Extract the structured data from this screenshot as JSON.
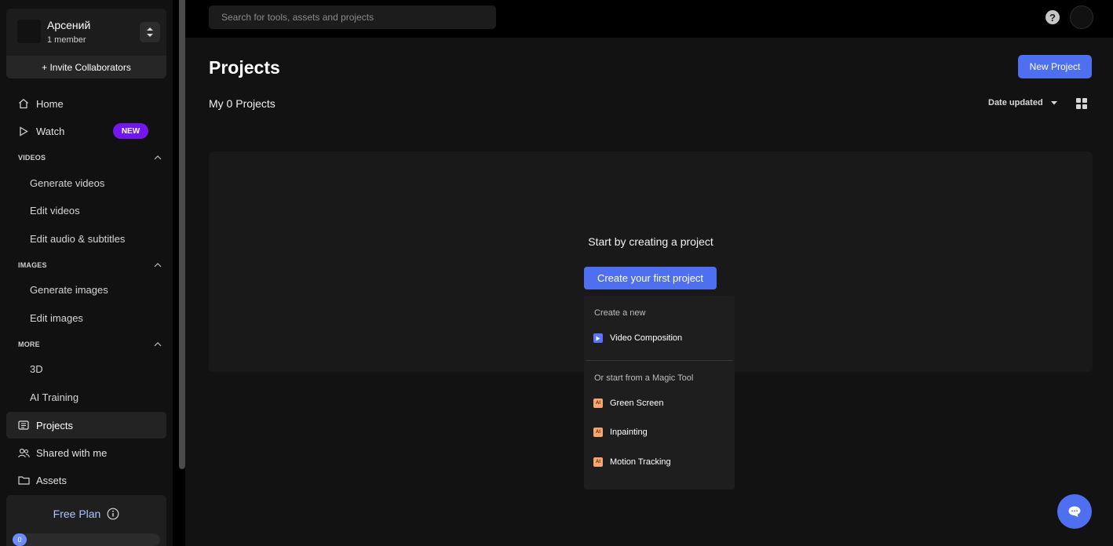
{
  "workspace": {
    "name": "Арсений",
    "members": "1 member",
    "invite_label": "+ Invite Collaborators"
  },
  "nav": {
    "home": "Home",
    "watch": "Watch",
    "watch_badge": "NEW",
    "videos_section": "VIDEOS",
    "videos_items": [
      "Generate videos",
      "Edit videos",
      "Edit audio & subtitles"
    ],
    "images_section": "IMAGES",
    "images_items": [
      "Generate images",
      "Edit images"
    ],
    "more_section": "MORE",
    "more_items": [
      "3D",
      "AI Training"
    ],
    "projects": "Projects",
    "shared": "Shared with me",
    "assets": "Assets"
  },
  "plan": {
    "label": "Free Plan",
    "usage_value": "0"
  },
  "search": {
    "placeholder": "Search for tools, assets and projects"
  },
  "header": {
    "help": "?"
  },
  "main": {
    "title": "Projects",
    "new_project_label": "New Project",
    "my_projects": "My 0 Projects",
    "sort_label": "Date updated",
    "empty_text": "Start by creating a project",
    "create_first_label": "Create your first project"
  },
  "dropdown": {
    "create_heading": "Create a new",
    "video_composition": "Video Composition",
    "magic_heading": "Or start from a Magic Tool",
    "ai_icon_text": "AI",
    "tools": [
      "Green Screen",
      "Inpainting",
      "Motion Tracking"
    ]
  },
  "colors": {
    "accent": "#4e6ff0",
    "badge": "#7317f0",
    "ai_icon": "#f7a670"
  },
  "icons": [
    "home-icon",
    "play-icon",
    "chevron-up-icon",
    "projects-icon",
    "users-icon",
    "folder-icon",
    "info-icon",
    "help-icon",
    "grid-icon",
    "caret-down-icon",
    "chat-icon",
    "up-down-icon"
  ]
}
